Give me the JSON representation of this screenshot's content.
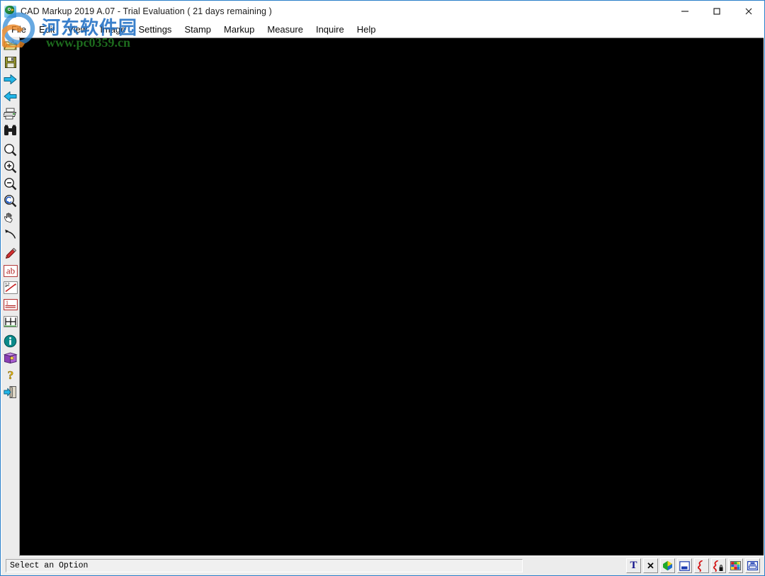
{
  "window": {
    "title": "CAD Markup 2019 A.07 - Trial Evaluation ( 21 days remaining )",
    "app_icon": "parrot-app-icon",
    "controls": [
      {
        "name": "minimize",
        "label": "—"
      },
      {
        "name": "maximize",
        "label": "□"
      },
      {
        "name": "close",
        "label": "✕"
      }
    ],
    "border_color": "#2a7fc9"
  },
  "menu": {
    "items": [
      {
        "label": "File"
      },
      {
        "label": "Edit"
      },
      {
        "label": "View"
      },
      {
        "label": "Image"
      },
      {
        "label": "Settings"
      },
      {
        "label": "Stamp"
      },
      {
        "label": "Markup"
      },
      {
        "label": "Measure"
      },
      {
        "label": "Inquire"
      },
      {
        "label": "Help"
      }
    ]
  },
  "left_toolbar": {
    "items": [
      {
        "icon": "open-folder-icon",
        "tooltip": "Open"
      },
      {
        "icon": "save-disk-icon",
        "tooltip": "Save"
      },
      {
        "icon": "next-arrow-icon",
        "tooltip": "Next"
      },
      {
        "icon": "previous-arrow-icon",
        "tooltip": "Previous"
      },
      {
        "icon": "print-icon",
        "tooltip": "Print"
      },
      {
        "icon": "binoculars-icon",
        "tooltip": "Find"
      },
      {
        "icon": "zoom-window-icon",
        "tooltip": "Zoom Window"
      },
      {
        "icon": "zoom-in-icon",
        "tooltip": "Zoom In"
      },
      {
        "icon": "zoom-out-icon",
        "tooltip": "Zoom Out"
      },
      {
        "icon": "zoom-previous-icon",
        "tooltip": "Zoom Previous"
      },
      {
        "icon": "pan-hand-icon",
        "tooltip": "Pan"
      },
      {
        "icon": "undo-arrow-icon",
        "tooltip": "Undo"
      },
      {
        "icon": "pencil-icon",
        "tooltip": "Pencil Markup"
      },
      {
        "icon": "text-ab-icon",
        "tooltip": "Text"
      },
      {
        "icon": "measure-distance-icon",
        "tooltip": "Measure Distance"
      },
      {
        "icon": "markup-line-icon",
        "tooltip": "Markup Line"
      },
      {
        "icon": "calibrate-icon",
        "tooltip": "Calibrate"
      },
      {
        "icon": "info-icon",
        "tooltip": "Information"
      },
      {
        "icon": "book-icon",
        "tooltip": "Manual"
      },
      {
        "icon": "question-help-icon",
        "tooltip": "Help"
      },
      {
        "icon": "exit-door-icon",
        "tooltip": "Exit"
      }
    ]
  },
  "canvas": {
    "background_color": "#000000"
  },
  "status_bar": {
    "message": "Select an Option",
    "tools": [
      {
        "icon": "text-tool-icon",
        "glyph": "T"
      },
      {
        "icon": "delete-x-icon",
        "glyph": "✕"
      },
      {
        "icon": "3d-shape-icon"
      },
      {
        "icon": "window-layout-icon"
      },
      {
        "icon": "lightning-red-icon"
      },
      {
        "icon": "lightning-lock-icon"
      },
      {
        "icon": "color-palette-icon"
      },
      {
        "icon": "scanner-icon"
      }
    ]
  },
  "watermark": {
    "site_name": "河东软件园",
    "url": "www.pc0359.cn",
    "cn_color": "#1f6fc4",
    "url_color": "#1d6b1d"
  }
}
